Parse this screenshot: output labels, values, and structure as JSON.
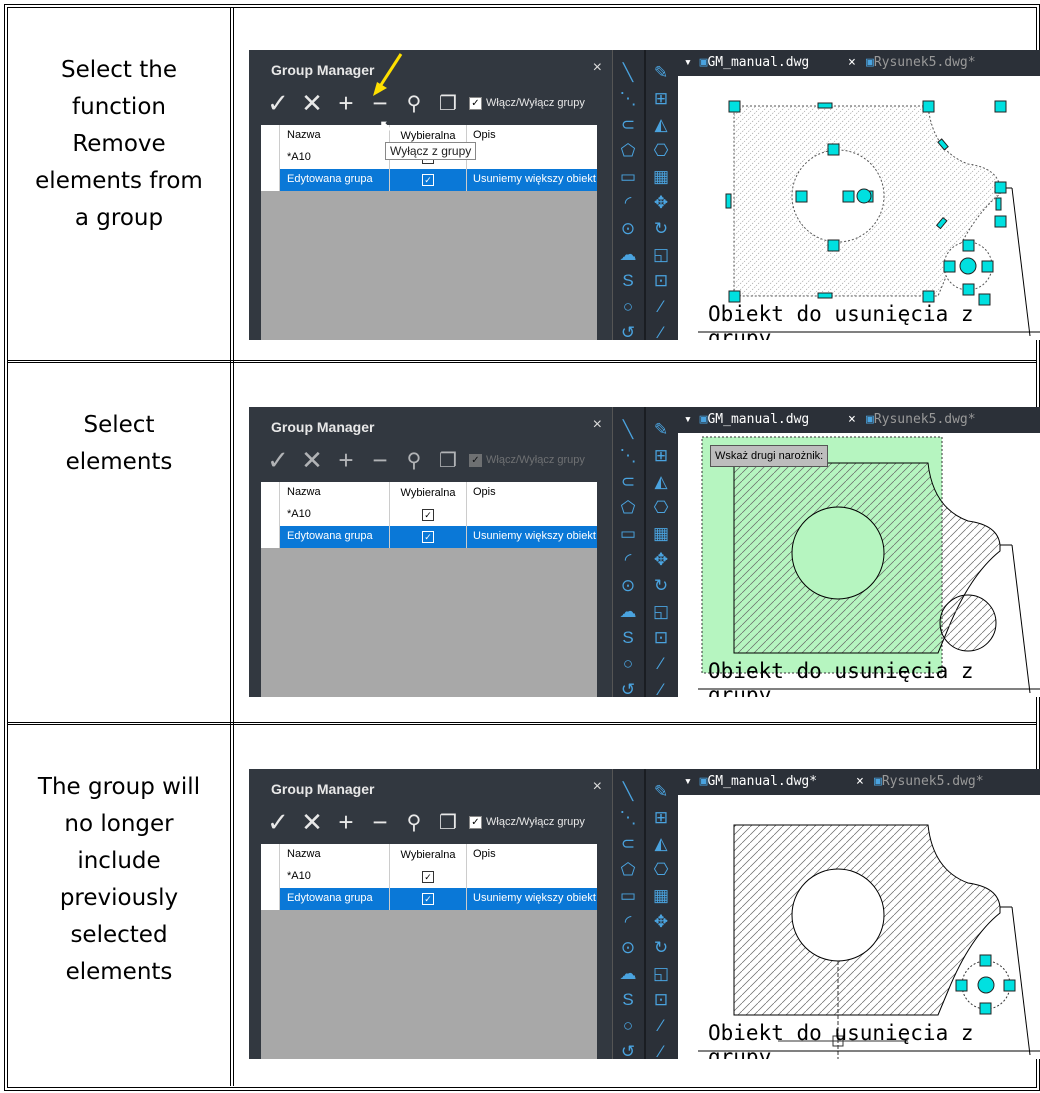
{
  "rows": [
    {
      "description": "Select the\nfunction\nRemove\nelements from\na group"
    },
    {
      "description": "Select\nelements"
    },
    {
      "description": "The group will\nno longer\ninclude\npreviously\nselected\nelements"
    }
  ],
  "panel": {
    "title": "Group Manager",
    "close": "×",
    "toolbar": {
      "accept": "✓",
      "delete": "✕",
      "add": "+",
      "remove": "−",
      "zoom": "⚲",
      "copy": "❐",
      "toggle_label": "Włącz/Wyłącz grupy"
    },
    "columns": {
      "name": "Nazwa",
      "selectable": "Wybieralna",
      "desc": "Opis"
    },
    "table": [
      {
        "name": "*A10",
        "check": "✓",
        "desc": ""
      },
      {
        "name": "Edytowana grupa",
        "check": "✓",
        "desc": "Usuniemy większy obiekt"
      }
    ],
    "tooltip": "Wyłącz z grupy"
  },
  "tabs": {
    "active_1": "GM_manual.dwg",
    "active_2": "GM_manual.dwg*",
    "close": "×",
    "other": "Rysunek5.dwg*"
  },
  "drawing": {
    "caption": "Obiekt do usunięcia z grupy",
    "prompt": "Wskaż drugi narożnik:"
  },
  "colors": {
    "accent": "#0a78d7",
    "grip": "#00e0e0",
    "window": "#b6f5c0"
  }
}
